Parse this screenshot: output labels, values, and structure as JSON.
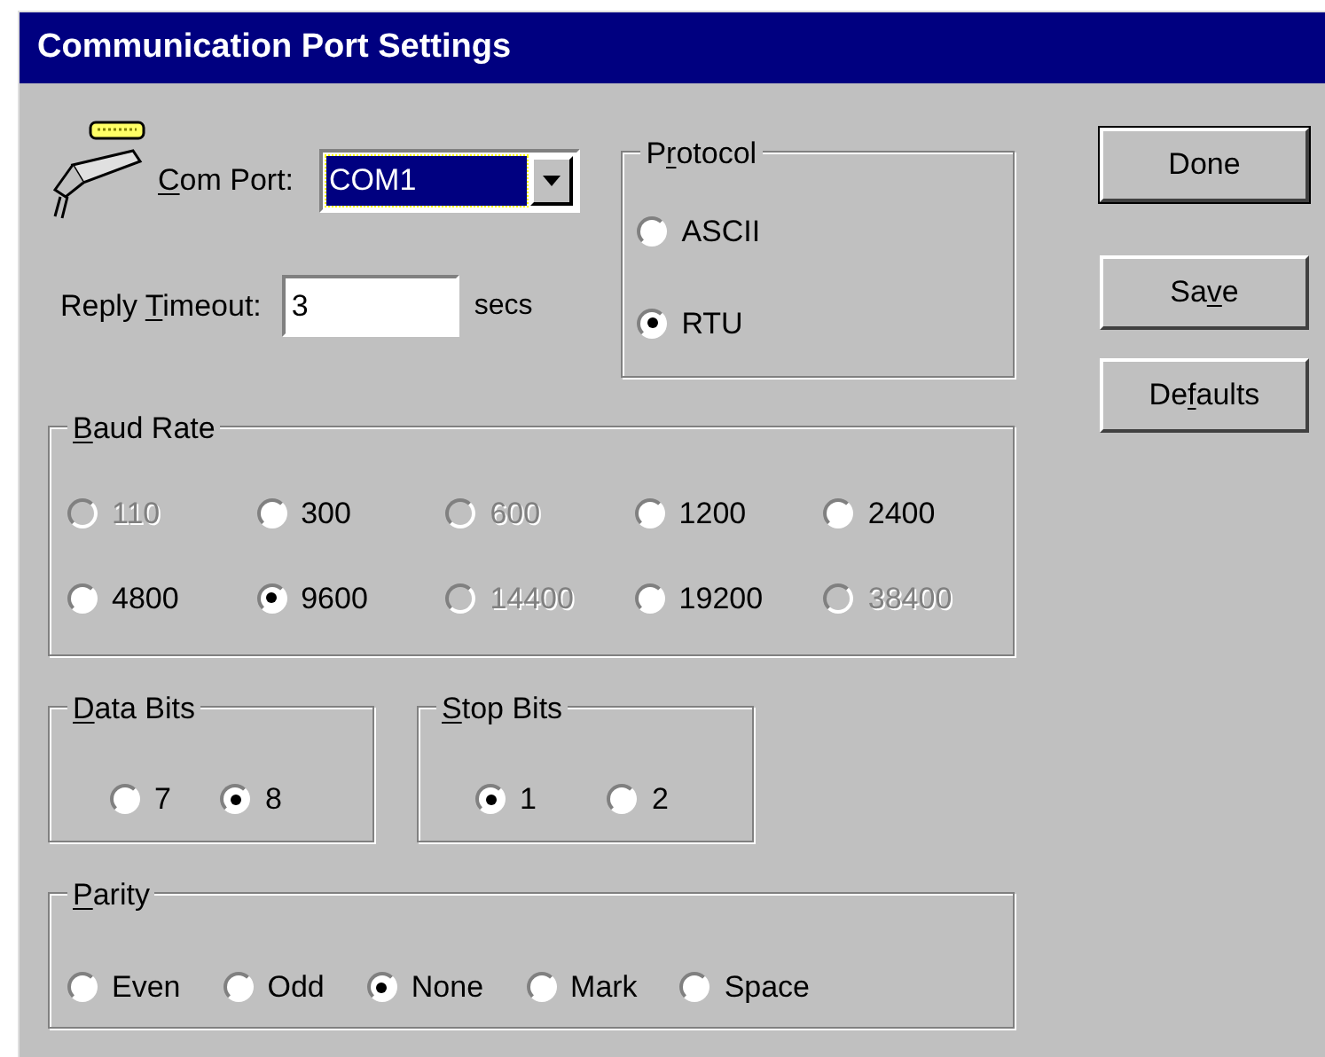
{
  "window": {
    "title": "Communication Port Settings"
  },
  "com_port": {
    "label": [
      {
        "text": "C",
        "underlined": true
      },
      {
        "text": "om Port:",
        "underlined": false
      }
    ],
    "value": "COM1",
    "focused": true
  },
  "reply_timeout": {
    "label": [
      {
        "text": "Reply ",
        "underlined": false
      },
      {
        "text": "T",
        "underlined": true
      },
      {
        "text": "imeout:",
        "underlined": false
      }
    ],
    "value": "3",
    "unit": "secs"
  },
  "protocol": {
    "title": [
      {
        "text": "P",
        "underlined": false
      },
      {
        "text": "r",
        "underlined": true
      },
      {
        "text": "otocol",
        "underlined": false
      }
    ],
    "options": [
      {
        "label": "ASCII",
        "selected": false,
        "disabled": false
      },
      {
        "label": "RTU",
        "selected": true,
        "disabled": false
      }
    ]
  },
  "baud_rate": {
    "title": [
      {
        "text": "B",
        "underlined": true
      },
      {
        "text": "aud Rate",
        "underlined": false
      }
    ],
    "options": [
      {
        "label": "110",
        "selected": false,
        "disabled": true
      },
      {
        "label": "300",
        "selected": false,
        "disabled": false
      },
      {
        "label": "600",
        "selected": false,
        "disabled": true
      },
      {
        "label": "1200",
        "selected": false,
        "disabled": false
      },
      {
        "label": "2400",
        "selected": false,
        "disabled": false
      },
      {
        "label": "4800",
        "selected": false,
        "disabled": false
      },
      {
        "label": "9600",
        "selected": true,
        "disabled": false
      },
      {
        "label": "14400",
        "selected": false,
        "disabled": true
      },
      {
        "label": "19200",
        "selected": false,
        "disabled": false
      },
      {
        "label": "38400",
        "selected": false,
        "disabled": true
      }
    ]
  },
  "data_bits": {
    "title": [
      {
        "text": "D",
        "underlined": true
      },
      {
        "text": "ata Bits",
        "underlined": false
      }
    ],
    "options": [
      {
        "label": "7",
        "selected": false,
        "disabled": false
      },
      {
        "label": "8",
        "selected": true,
        "disabled": false
      }
    ]
  },
  "stop_bits": {
    "title": [
      {
        "text": "S",
        "underlined": true
      },
      {
        "text": "top Bits",
        "underlined": false
      }
    ],
    "options": [
      {
        "label": "1",
        "selected": true,
        "disabled": false
      },
      {
        "label": "2",
        "selected": false,
        "disabled": false
      }
    ]
  },
  "parity": {
    "title": [
      {
        "text": "P",
        "underlined": true
      },
      {
        "text": "arity",
        "underlined": false
      }
    ],
    "options": [
      {
        "label": "Even",
        "selected": false,
        "disabled": false
      },
      {
        "label": "Odd",
        "selected": false,
        "disabled": false
      },
      {
        "label": "None",
        "selected": true,
        "disabled": false
      },
      {
        "label": "Mark",
        "selected": false,
        "disabled": false
      },
      {
        "label": "Space",
        "selected": false,
        "disabled": false
      }
    ]
  },
  "buttons": [
    {
      "label": [
        {
          "text": "Done",
          "underlined": false
        }
      ],
      "default": true
    },
    {
      "label": [
        {
          "text": "Sa",
          "underlined": false
        },
        {
          "text": "v",
          "underlined": true
        },
        {
          "text": "e",
          "underlined": false
        }
      ],
      "default": false
    },
    {
      "label": [
        {
          "text": "De",
          "underlined": false
        },
        {
          "text": "f",
          "underlined": true
        },
        {
          "text": "aults",
          "underlined": false
        }
      ],
      "default": false
    }
  ]
}
